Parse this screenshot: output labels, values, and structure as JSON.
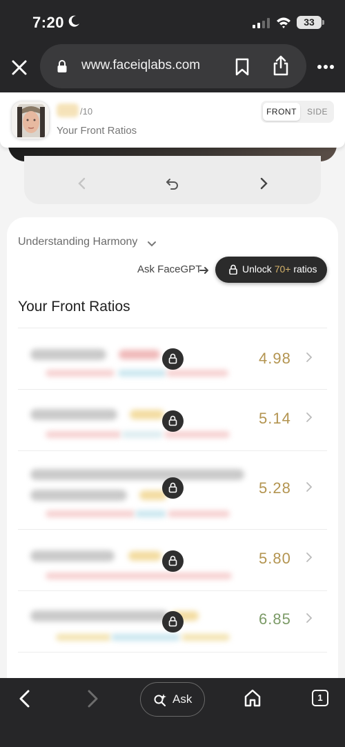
{
  "status_bar": {
    "time": "7:20",
    "battery": "33"
  },
  "browser": {
    "url": "www.faceiqlabs.com"
  },
  "sticky_header": {
    "score_denominator": "/10",
    "subtitle": "Your Front Ratios",
    "toggle_front": "FRONT",
    "toggle_side": "SIDE",
    "active_view": "FRONT"
  },
  "main": {
    "harmony_label": "Understanding Harmony",
    "ask_gpt_label": "Ask FaceGPT",
    "unlock_prefix": "Unlock ",
    "unlock_count": "70+",
    "unlock_suffix": " ratios",
    "section_title": "Your Front Ratios",
    "ratios": [
      {
        "value": "4.98",
        "locked": true,
        "color": "#b39450"
      },
      {
        "value": "5.14",
        "locked": true,
        "color": "#b39450"
      },
      {
        "value": "5.28",
        "locked": true,
        "color": "#b39450"
      },
      {
        "value": "5.80",
        "locked": true,
        "color": "#b39450"
      },
      {
        "value": "6.85",
        "locked": true,
        "color": "#7b9a66"
      }
    ]
  },
  "bottom_bar": {
    "ask_label": "Ask",
    "tab_count": "1"
  },
  "colors": {
    "accent_gold": "#d4b26a",
    "dark_chrome": "#262628"
  }
}
